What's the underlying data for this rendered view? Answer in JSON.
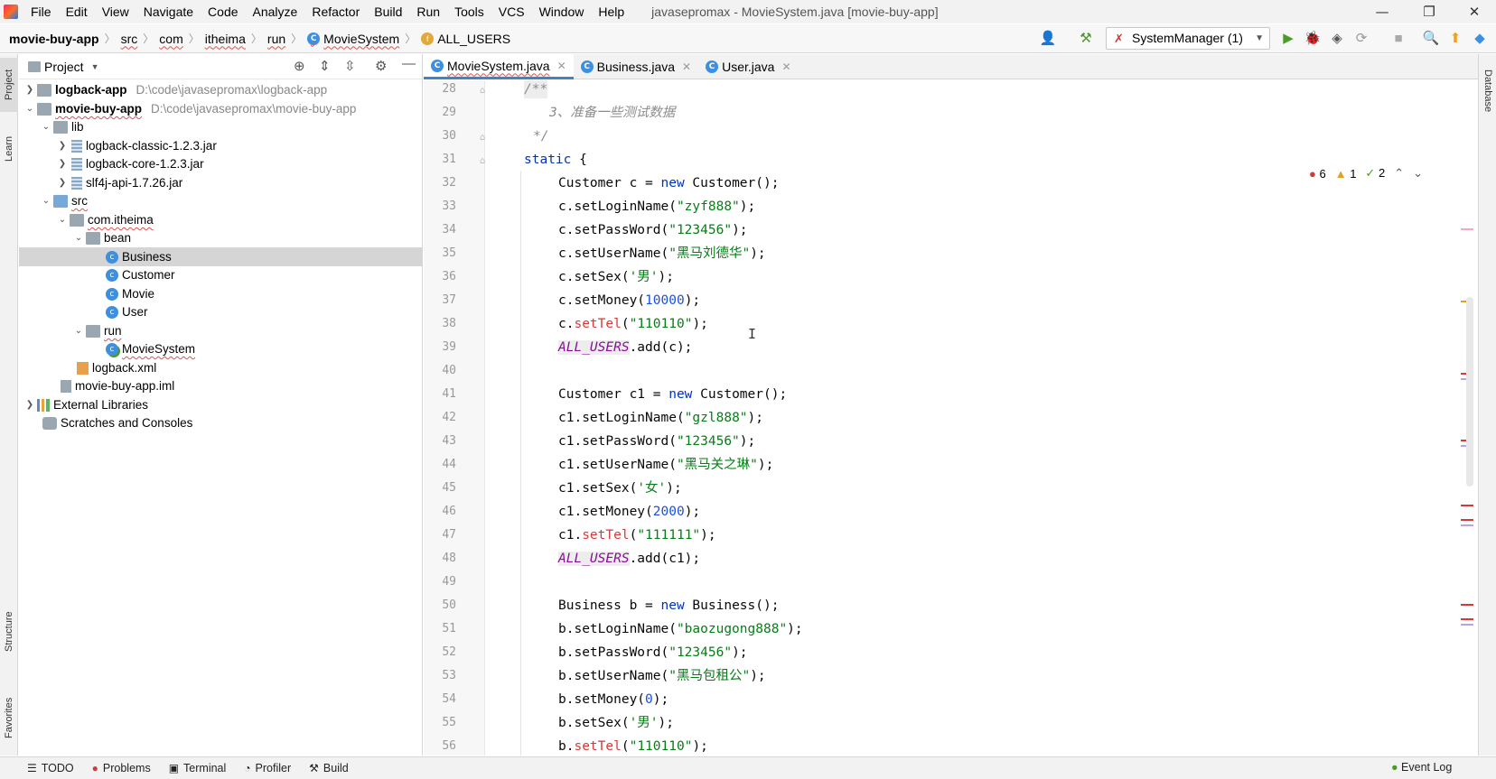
{
  "app": {
    "window_title": "javasepromax - MovieSystem.java [movie-buy-app]",
    "menu": [
      "File",
      "Edit",
      "View",
      "Navigate",
      "Code",
      "Analyze",
      "Refactor",
      "Build",
      "Run",
      "Tools",
      "VCS",
      "Window",
      "Help"
    ]
  },
  "breadcrumb": [
    "movie-buy-app",
    "src",
    "com",
    "itheima",
    "run",
    "MovieSystem",
    "ALL_USERS"
  ],
  "run_config": "SystemManager (1)",
  "colors": {
    "accent": "#4083c9",
    "keyword": "#0033b3",
    "string": "#067d17",
    "number": "#1750eb",
    "comment": "#8c8c8c",
    "constant": "#871094",
    "error": "#d33b3b"
  },
  "left_stripe": {
    "project": "Project",
    "learn": "Learn",
    "structure": "Structure",
    "favorites": "Favorites"
  },
  "right_stripe": {
    "database": "Database"
  },
  "project_panel": {
    "title": "Project",
    "tree": [
      {
        "label": "logback-app",
        "path": "D:\\code\\javasepromax\\logback-app",
        "icon": "module-folder-icon",
        "expanded": false,
        "bold": true
      },
      {
        "label": "movie-buy-app",
        "path": "D:\\code\\javasepromax\\movie-buy-app",
        "icon": "module-folder-icon",
        "expanded": true,
        "bold": true
      },
      {
        "label": "lib",
        "icon": "folder-icon"
      },
      {
        "label": "logback-classic-1.2.3.jar",
        "icon": "jar-icon"
      },
      {
        "label": "logback-core-1.2.3.jar",
        "icon": "jar-icon"
      },
      {
        "label": "slf4j-api-1.7.26.jar",
        "icon": "jar-icon"
      },
      {
        "label": "src",
        "icon": "source-folder-icon"
      },
      {
        "label": "com.itheima",
        "icon": "package-icon"
      },
      {
        "label": "bean",
        "icon": "package-icon"
      },
      {
        "label": "Business",
        "icon": "class-icon",
        "selected": true
      },
      {
        "label": "Customer",
        "icon": "class-icon"
      },
      {
        "label": "Movie",
        "icon": "class-icon"
      },
      {
        "label": "User",
        "icon": "class-icon"
      },
      {
        "label": "run",
        "icon": "package-icon"
      },
      {
        "label": "MovieSystem",
        "icon": "main-class-icon"
      },
      {
        "label": "logback.xml",
        "icon": "xml-icon"
      },
      {
        "label": "movie-buy-app.iml",
        "icon": "iml-icon"
      },
      {
        "label": "External Libraries",
        "icon": "libraries-icon"
      },
      {
        "label": "Scratches and Consoles",
        "icon": "scratch-icon"
      }
    ]
  },
  "editor": {
    "tabs": [
      {
        "label": "MovieSystem.java",
        "active": true
      },
      {
        "label": "Business.java",
        "active": false
      },
      {
        "label": "User.java",
        "active": false
      }
    ],
    "inspections": {
      "errors": "6",
      "warnings": "1",
      "ok": "2"
    },
    "line_numbers": [
      "28",
      "29",
      "30",
      "31",
      "32",
      "33",
      "34",
      "35",
      "36",
      "37",
      "38",
      "39",
      "40",
      "41",
      "42",
      "43",
      "44",
      "45",
      "46",
      "47",
      "48",
      "49",
      "50",
      "51",
      "52",
      "53",
      "54",
      "55",
      "56"
    ],
    "code": {
      "l28": "/**",
      "l29": "3、准备一些测试数据",
      "l30": "*/",
      "l31_kw": "static",
      "l31_rest": " {",
      "l32_a": "Customer c = ",
      "l32_kw": "new",
      "l32_b": " Customer();",
      "l33_a": "c.setLoginName(",
      "l33_s": "\"zyf888\"",
      "l33_b": ");",
      "l34_a": "c.setPassWord(",
      "l34_s": "\"123456\"",
      "l34_b": ");",
      "l35_a": "c.setUserName(",
      "l35_s": "\"黑马刘德华\"",
      "l35_b": ");",
      "l36_a": "c.setSex(",
      "l36_s": "'男'",
      "l36_b": ");",
      "l37_a": "c.setMoney(",
      "l37_n": "10000",
      "l37_b": ");",
      "l38_a": "c.",
      "l38_r": "setTel",
      "l38_b": "(",
      "l38_s": "\"110110\"",
      "l38_c": ");",
      "l39_k": "ALL_USERS",
      "l39_b": ".add(c);",
      "l41_a": "Customer c1 = ",
      "l41_kw": "new",
      "l41_b": " Customer();",
      "l42_a": "c1.setLoginName(",
      "l42_s": "\"gzl888\"",
      "l42_b": ");",
      "l43_a": "c1.setPassWord(",
      "l43_s": "\"123456\"",
      "l43_b": ");",
      "l44_a": "c1.setUserName(",
      "l44_s": "\"黑马关之琳\"",
      "l44_b": ");",
      "l45_a": "c1.setSex(",
      "l45_s": "'女'",
      "l45_b": ");",
      "l46_a": "c1.setMoney(",
      "l46_n": "2000",
      "l46_b": ");",
      "l47_a": "c1.",
      "l47_r": "setTel",
      "l47_b": "(",
      "l47_s": "\"111111\"",
      "l47_c": ");",
      "l48_k": "ALL_USERS",
      "l48_b": ".add(c1);",
      "l50_a": "Business b = ",
      "l50_kw": "new",
      "l50_b": " Business();",
      "l51_a": "b.setLoginName(",
      "l51_s": "\"baozugong888\"",
      "l51_b": ");",
      "l52_a": "b.setPassWord(",
      "l52_s": "\"123456\"",
      "l52_b": ");",
      "l53_a": "b.setUserName(",
      "l53_s": "\"黑马包租公\"",
      "l53_b": ");",
      "l54_a": "b.setMoney(",
      "l54_n": "0",
      "l54_b": ");",
      "l55_a": "b.setSex(",
      "l55_s": "'男'",
      "l55_b": ");",
      "l56_a": "b.",
      "l56_r": "setTel",
      "l56_b": "(",
      "l56_s": "\"110110\"",
      "l56_c": ");"
    }
  },
  "bottom_tools": [
    "TODO",
    "Problems",
    "Terminal",
    "Profiler",
    "Build"
  ],
  "status_right": "Event Log"
}
